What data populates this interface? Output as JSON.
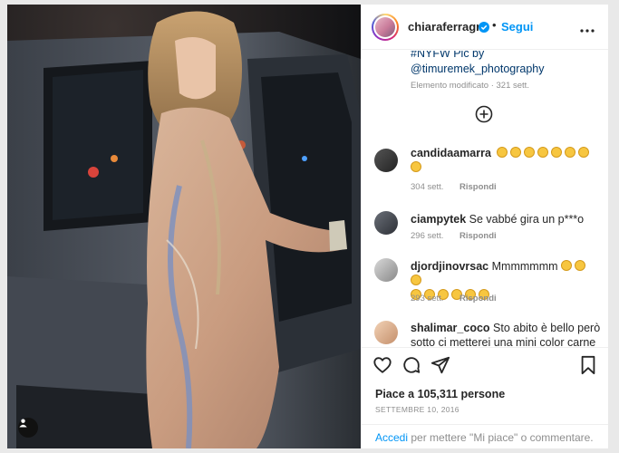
{
  "post": {
    "username": "chiaraferragni",
    "follow_label": "Segui",
    "separator": "•",
    "caption_tag": "#NYFW Pic by",
    "caption_mention": "@timuremek_photography",
    "caption_meta": "Elemento modificato · 321 sett."
  },
  "comments": [
    {
      "user": "candidaamarra",
      "text": "",
      "emoji_count": 8,
      "time": "304 sett.",
      "reply_label": "Rispondi"
    },
    {
      "user": "ciampytek",
      "text": "Se vabbé gira un p***o",
      "time": "296 sett.",
      "reply_label": "Rispondi"
    },
    {
      "user": "djordjinovrsac",
      "text": "Mmmmmmm",
      "emoji_count": 9,
      "time": "293 sett.",
      "reply_label": "Rispondi"
    },
    {
      "user": "shalimar_coco",
      "text": "Sto abito è bello però sotto ci metterei una mini color carne o",
      "time": "",
      "reply_label": ""
    }
  ],
  "actions": {
    "likes": "Piace a 105,311 persone",
    "date": "SETTEMBRE 10, 2016"
  },
  "login_prompt": {
    "link": "Accedi",
    "rest": " per mettere \"Mi piace\" o commentare."
  },
  "colors": {
    "accent": "#0095f6",
    "link": "#00376b",
    "muted": "#8e8e8e"
  },
  "icons": [
    "verified-badge-icon",
    "more-options-icon",
    "load-more-icon",
    "heart-icon",
    "comment-icon",
    "share-icon",
    "bookmark-icon",
    "tag-user-icon"
  ]
}
